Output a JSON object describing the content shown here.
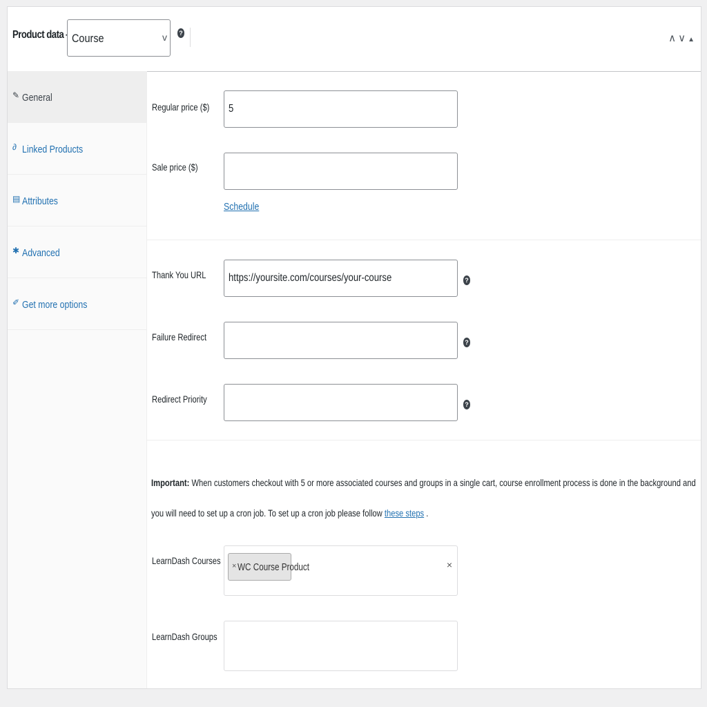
{
  "header": {
    "title": "Product data —",
    "product_type": "Course",
    "help_icon": "help-icon",
    "controls": [
      "move-up-icon",
      "move-down-icon",
      "toggle-panel-icon"
    ]
  },
  "tabs": [
    {
      "label": "General",
      "icon": "wrench-icon",
      "active": true
    },
    {
      "label": "Linked Products",
      "icon": "link-icon",
      "active": false
    },
    {
      "label": "Attributes",
      "icon": "list-icon",
      "active": false
    },
    {
      "label": "Advanced",
      "icon": "gear-icon",
      "active": false
    },
    {
      "label": "Get more options",
      "icon": "plugin-icon",
      "active": false
    }
  ],
  "pricing": {
    "regular_price_label": "Regular price ($)",
    "regular_price_value": "5",
    "sale_price_label": "Sale price ($)",
    "sale_price_value": "",
    "schedule_link": "Schedule"
  },
  "redirects": {
    "thank_you_label": "Thank You URL",
    "thank_you_value": "https://yoursite.com/courses/your-course",
    "failure_label": "Failure Redirect",
    "failure_value": "",
    "priority_label": "Redirect Priority",
    "priority_value": ""
  },
  "notice": {
    "strong": "Important:",
    "text": " When customers checkout with 5 or more associated courses and groups in a single cart, course enrollment process is done in the background and you will need to set up a cron job. To set up a cron job please follow ",
    "link": "these steps",
    "end": " ."
  },
  "learndash": {
    "courses_label": "LearnDash Courses",
    "selected_course": "WC Course Product",
    "groups_label": "LearnDash Groups"
  },
  "colors": {
    "link": "#2271b1",
    "border": "#8c8f94",
    "background": "#f0f0f1"
  }
}
